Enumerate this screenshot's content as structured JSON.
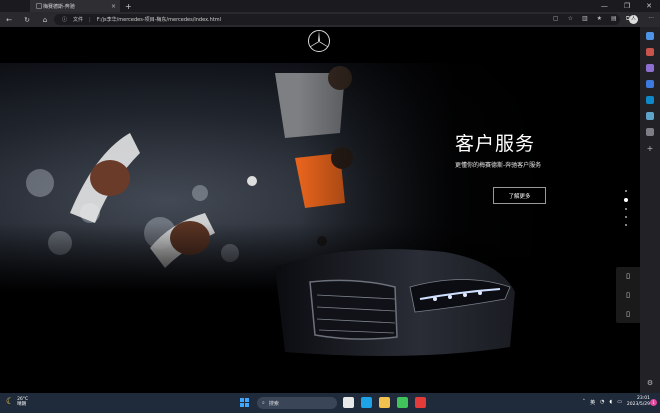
{
  "browser": {
    "tab_title": "梅赛德斯-奔驰",
    "tab_close": "×",
    "new_tab": "+",
    "address_label": "文件",
    "address_url": "F:/js李华/mercedes-项目-梅东/mercedes/index.html",
    "avatar_letter": "人"
  },
  "page": {
    "hero_title": "客户服务",
    "hero_subtitle": "更懂你的梅赛德斯-奔驰客户服务",
    "hero_button": "了解更多",
    "carousel": {
      "count": 5,
      "active_index": 1
    }
  },
  "taskbar": {
    "weather_temp": "26°C",
    "weather_desc": "晴朗",
    "search_placeholder": "搜索",
    "ime": "英",
    "time": "23:01",
    "date": "2023/5/29",
    "notifications": "1"
  },
  "colors": {
    "accent": "#3fa7ff",
    "page_bg": "#000000",
    "taskbar_bg": "#1f2a3a"
  }
}
